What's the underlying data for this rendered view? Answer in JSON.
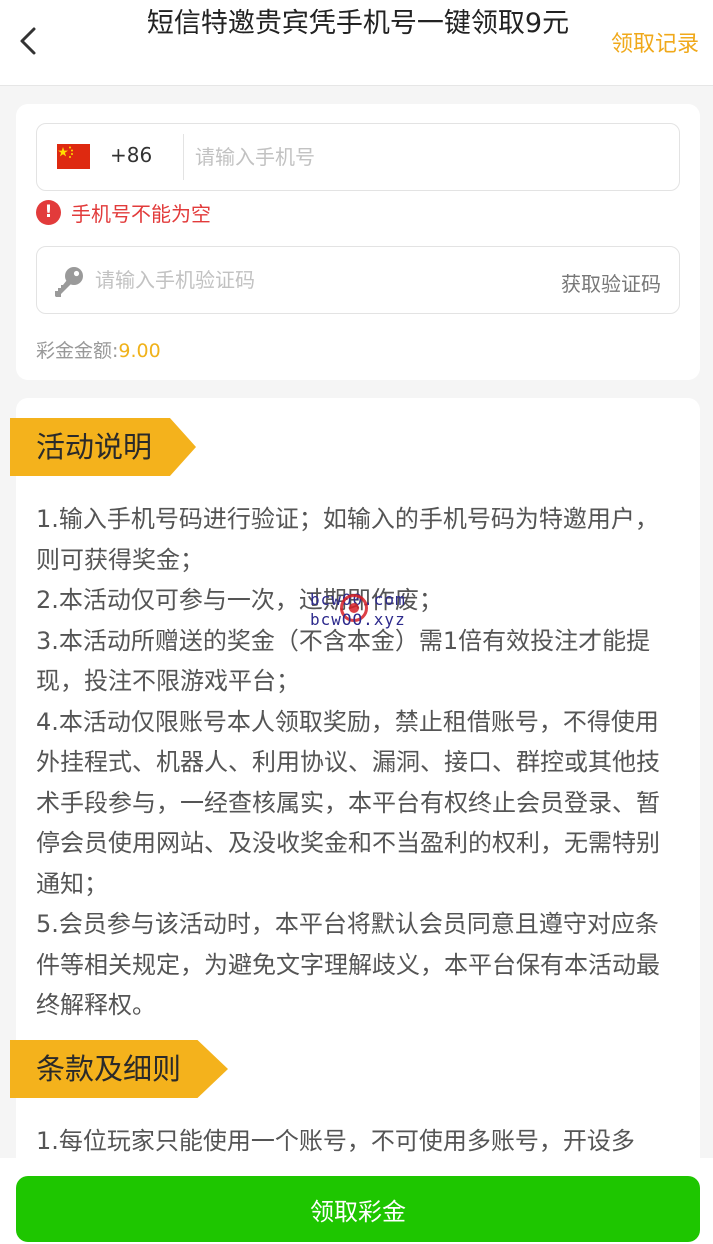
{
  "header": {
    "title": "短信特邀贵宾凭手机号一键领取9元",
    "record_link": "领取记录"
  },
  "form": {
    "country_code": "+86",
    "phone_placeholder": "请输入手机号",
    "phone_value": "",
    "error_text": "手机号不能为空",
    "code_placeholder": "请输入手机验证码",
    "code_value": "",
    "get_code": "获取验证码",
    "bonus_label": "彩金金额:",
    "bonus_value": "9.00"
  },
  "activity": {
    "title": "活动说明",
    "lines": [
      "1.输入手机号码进行验证；如输入的手机号码为特邀用户，则可获得奖金；",
      "2.本活动仅可参与一次，过期即作废；",
      "3.本活动所赠送的奖金（不含本金）需1倍有效投注才能提现，投注不限游戏平台；",
      "4.本活动仅限账号本人领取奖励，禁止租借账号，不得使用外挂程式、机器人、利用协议、漏洞、接口、群控或其他技术手段参与，一经查核属实，本平台有权终止会员登录、暂停会员使用网站、及没收奖金和不当盈利的权利，无需特别通知；",
      "5.会员参与该活动时，本平台将默认会员同意且遵守对应条件等相关规定，为避免文字理解歧义，本平台保有本活动最终解释权。"
    ]
  },
  "terms": {
    "title": "条款及细则",
    "lines": [
      "1.每位玩家只能使用一个账号，不可使用多账号，开设多"
    ]
  },
  "watermark": {
    "line1": "bcw00.com",
    "line2": "bcwOO.xyz"
  },
  "footer": {
    "claim_button": "领取彩金"
  },
  "colors": {
    "accent_orange": "#f4b21c",
    "record_orange": "#f0a91b",
    "error_red": "#e23b3b",
    "button_green": "#1ec600",
    "bonus_yellow": "#f0b21b"
  },
  "icons": {
    "back": "chevron-left-icon",
    "flag": "china-flag-icon",
    "error": "exclamation-circle-icon",
    "key": "key-icon"
  }
}
